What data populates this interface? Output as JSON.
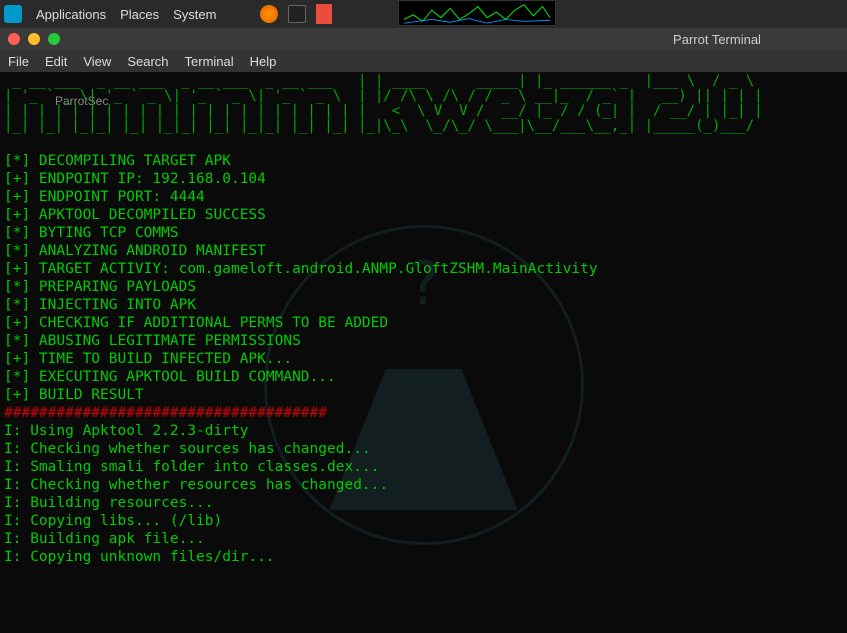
{
  "topbar": {
    "applications": "Applications",
    "places": "Places",
    "system": "System"
  },
  "window": {
    "title": "Parrot Terminal"
  },
  "menubar": {
    "file": "File",
    "edit": "Edit",
    "view": "View",
    "search": "Search",
    "terminal": "Terminal",
    "help": "Help"
  },
  "desktop": {
    "parrotsec": "ParrotSec"
  },
  "ascii_art": " _ __ ___  _ __ ___  _ __ ___  _ __ ___   | | ____      _____| |_ ______ _  |___ \\  / _ \\ \n| '_ ` _ \\| '_ ` _ \\| '_ ` _ \\| '_ ` _ \\  | |/ /\\ \\ /\\ / / _ \\ __|_  / _` |   __) || | | |\n| | | | | | | | | | | | | | | | | | | | | |   <  \\ V  V /  __/ |_ / / (_| |  / __/ | |_| |\n|_| |_| |_|_| |_| |_|_| |_| |_|_| |_| |_| |_|\\_\\  \\_/\\_/ \\___|\\__/___\\__,_| |_____(_)___/ ",
  "terminal": {
    "lines": [
      "[*] DECOMPILING TARGET APK",
      "[+] ENDPOINT IP: 192.168.0.104",
      "[+] ENDPOINT PORT: 4444",
      "[+] APKTOOL DECOMPILED SUCCESS",
      "[*] BYTING TCP COMMS",
      "[*] ANALYZING ANDROID MANIFEST",
      "[+] TARGET ACTIVIY: com.gameloft.android.ANMP.GloftZSHM.MainActivity",
      "[*] PREPARING PAYLOADS",
      "[*] INJECTING INTO APK",
      "[+] CHECKING IF ADDITIONAL PERMS TO BE ADDED",
      "[*] ABUSING LEGITIMATE PERMISSIONS",
      "[+] TIME TO BUILD INFECTED APK...",
      "[*] EXECUTING APKTOOL BUILD COMMAND...",
      "[+] BUILD RESULT"
    ],
    "hash_line": "#####################################",
    "build_output": [
      "I: Using Apktool 2.2.3-dirty",
      "I: Checking whether sources has changed...",
      "I: Smaling smali folder into classes.dex...",
      "I: Checking whether resources has changed...",
      "I: Building resources...",
      "I: Copying libs... (/lib)",
      "I: Building apk file...",
      "I: Copying unknown files/dir..."
    ]
  }
}
